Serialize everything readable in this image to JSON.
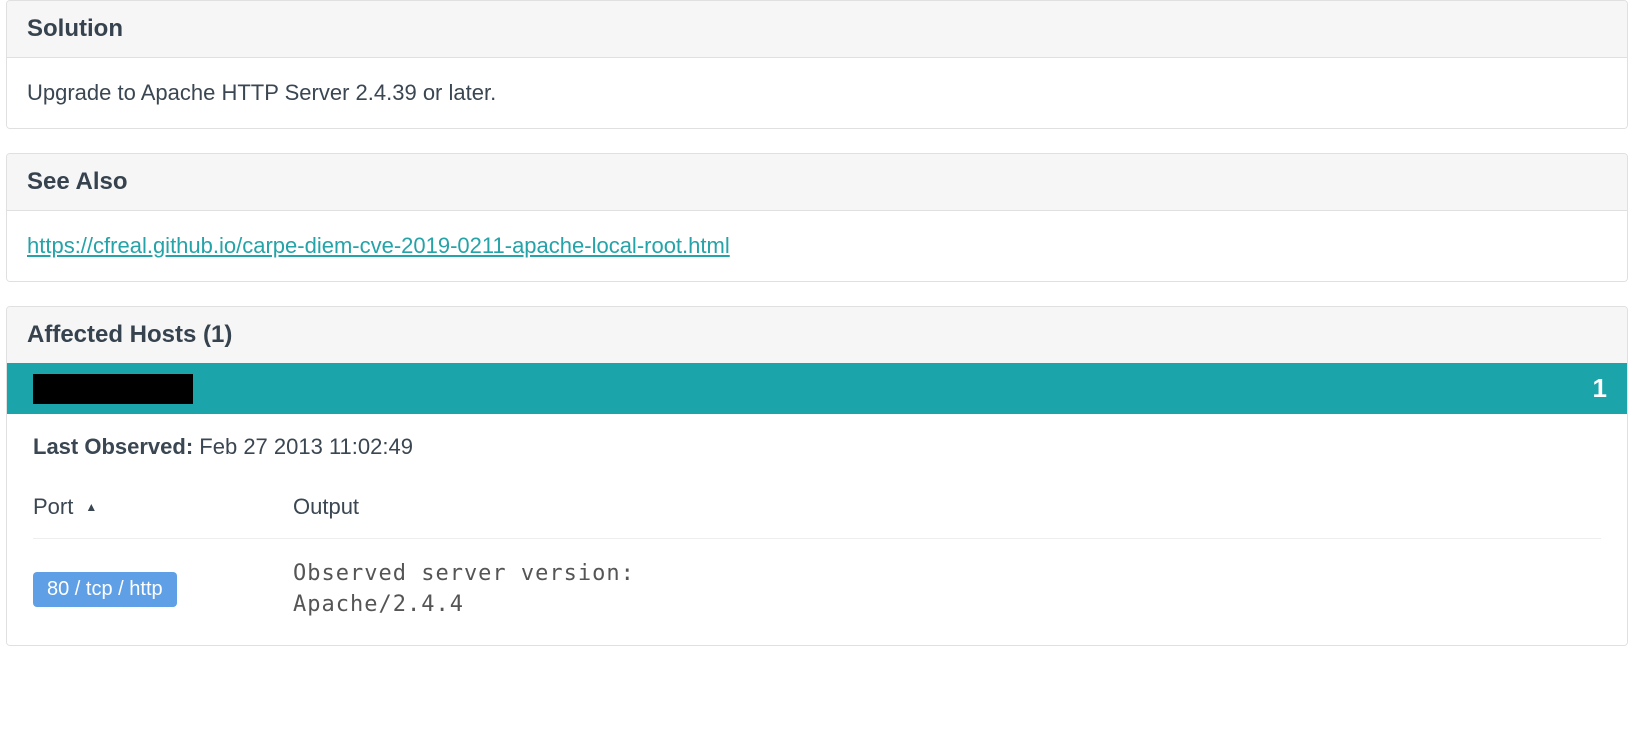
{
  "solution": {
    "title": "Solution",
    "body": "Upgrade to Apache HTTP Server 2.4.39 or later."
  },
  "see_also": {
    "title": "See Also",
    "link": "https://cfreal.github.io/carpe-diem-cve-2019-0211-apache-local-root.html"
  },
  "affected_hosts": {
    "title": "Affected Hosts (1)",
    "host_count": "1",
    "last_observed_label": "Last Observed:",
    "last_observed_value": "Feb 27 2013 11:02:49",
    "columns": {
      "port": "Port",
      "output": "Output"
    },
    "rows": [
      {
        "port": "80 / tcp / http",
        "output": "Observed server version:\nApache/2.4.4"
      }
    ]
  }
}
